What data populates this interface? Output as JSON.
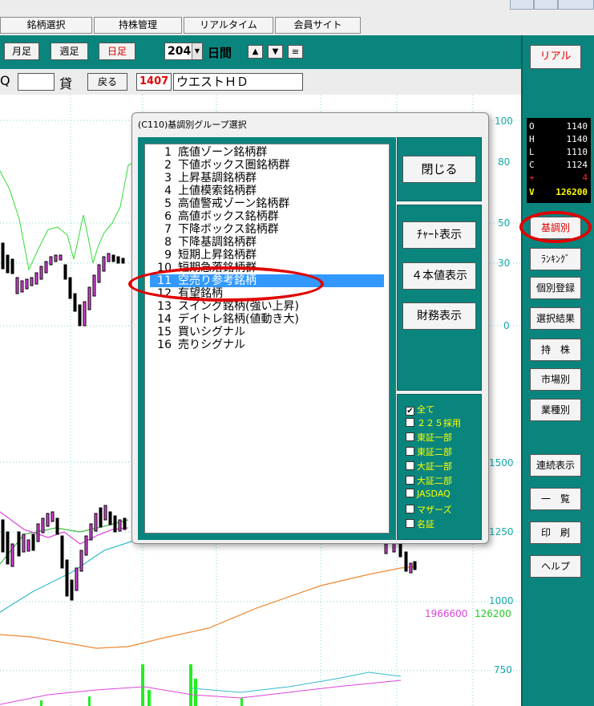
{
  "menu": {
    "items": [
      "銘柄選択",
      "持株管理",
      "リアルタイム",
      "会員サイト"
    ]
  },
  "toolbar1": {
    "monthly": "月足",
    "weekly": "週足",
    "daily": "日足",
    "period_value": "204",
    "period_unit": "日間",
    "up_arrow": "▲",
    "down_arrow": "▼",
    "menu_icon": "≡"
  },
  "toolbar2": {
    "market_suffix": "Q",
    "lending": "貸",
    "back": "戻る",
    "code": "1407",
    "name": "ウエストＨＤ"
  },
  "chart": {
    "right_axis_top": [
      "100",
      "80",
      "50",
      "30",
      "0"
    ],
    "right_axis_price": [
      "1500",
      "1250",
      "1000",
      "750"
    ],
    "volume_value_1": "1966600",
    "volume_value_2": "126200",
    "colors": {
      "background": "#ffffff",
      "osc_line": "#33dd33",
      "axis": "#1aa7a7",
      "candle_pink": "#dd44dd",
      "ma_orange": "#ee8833",
      "ma_cyan": "#33bbcc"
    }
  },
  "quote": {
    "rows": [
      {
        "k": "O",
        "v": "1140"
      },
      {
        "k": "H",
        "v": "1140"
      },
      {
        "k": "L",
        "v": "1110"
      },
      {
        "k": "C",
        "v": "1124"
      },
      {
        "k": "+",
        "v": "4"
      },
      {
        "k": "V",
        "v": "126200"
      }
    ]
  },
  "right_panel": {
    "realtime": "リアル",
    "fundamental": "基調別",
    "ranking": "ﾗﾝｷﾝｸﾞ",
    "individual": "個別登録",
    "selection": "選択結果",
    "holdings": "持　株",
    "market": "市場別",
    "industry": "業種別",
    "continuous": "連続表示",
    "list": "一　覧",
    "print": "印　刷",
    "help": "ヘルプ"
  },
  "dialog": {
    "title": "(C110)基調別グループ選択",
    "items": [
      {
        "n": "1",
        "label": "底値ゾーン銘柄群"
      },
      {
        "n": "2",
        "label": "下値ボックス圏銘柄群"
      },
      {
        "n": "3",
        "label": "上昇基調銘柄群"
      },
      {
        "n": "4",
        "label": "上値模索銘柄群"
      },
      {
        "n": "5",
        "label": "高値警戒ゾーン銘柄群"
      },
      {
        "n": "6",
        "label": "高値ボックス銘柄群"
      },
      {
        "n": "7",
        "label": "下降ボックス銘柄群"
      },
      {
        "n": "8",
        "label": "下降基調銘柄群"
      },
      {
        "n": "9",
        "label": "短期上昇銘柄群"
      },
      {
        "n": "10",
        "label": "短期急落銘柄群"
      },
      {
        "n": "11",
        "label": "空売り参考銘柄"
      },
      {
        "n": "12",
        "label": "有望銘柄"
      },
      {
        "n": "13",
        "label": "スイング銘柄(強い上昇)"
      },
      {
        "n": "14",
        "label": "デイトレ銘柄(値動き大)"
      },
      {
        "n": "15",
        "label": "買いシグナル"
      },
      {
        "n": "16",
        "label": "売りシグナル"
      }
    ],
    "selected_index": 10,
    "close": "閉じる",
    "chart_view": "ﾁｬｰﾄ表示",
    "four_values": "４本値表示",
    "financial": "財務表示",
    "markets": [
      {
        "label": "全て",
        "checked": true
      },
      {
        "label": "２２５採用",
        "checked": false
      },
      {
        "label": "東証一部",
        "checked": false
      },
      {
        "label": "東証二部",
        "checked": false
      },
      {
        "label": "大証一部",
        "checked": false
      },
      {
        "label": "大証二部",
        "checked": false
      },
      {
        "label": "JASDAQ",
        "checked": false
      },
      {
        "label": "マザーズ",
        "checked": false
      },
      {
        "label": "名証",
        "checked": false
      }
    ]
  }
}
